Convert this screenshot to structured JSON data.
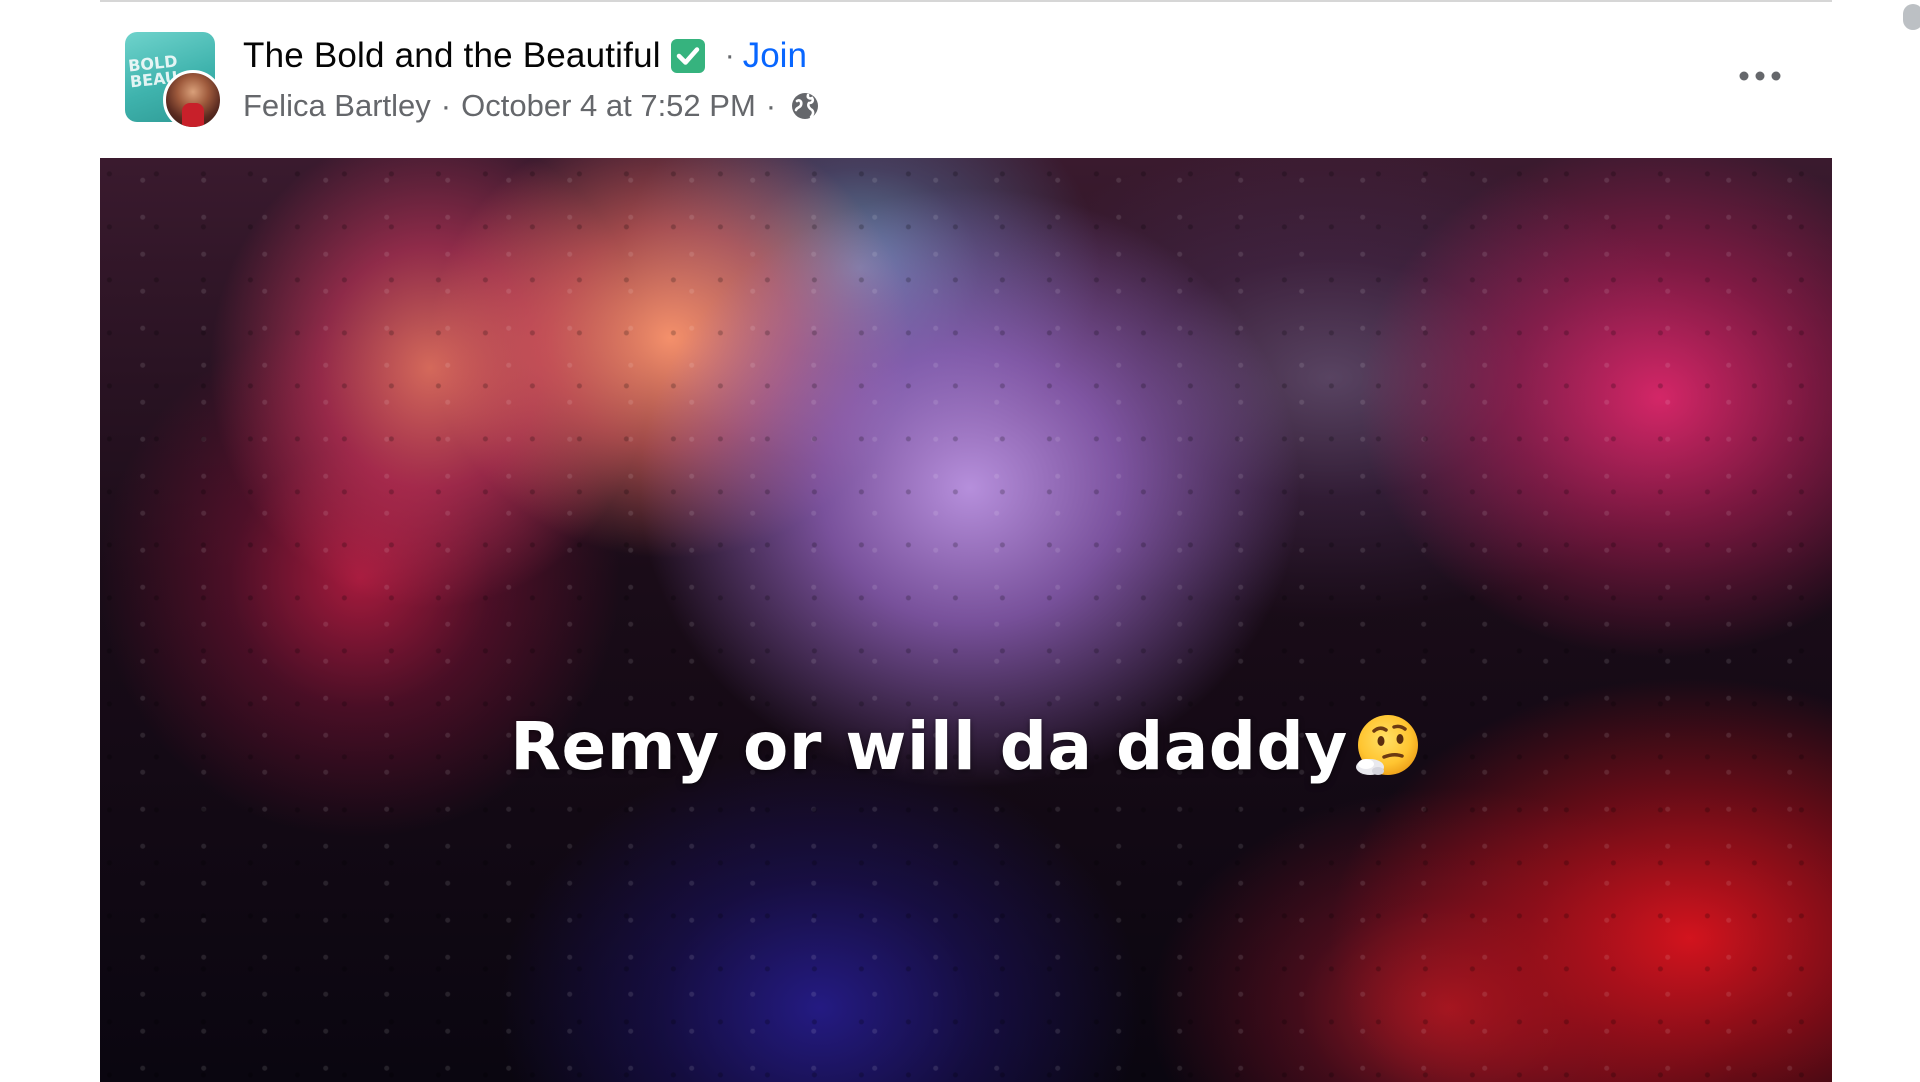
{
  "post": {
    "group_name": "The Bold and the Beautiful",
    "group_avatar_text": "BOLD BEAU",
    "join_label": "Join",
    "dot": "·",
    "author": "Felica Bartley",
    "timestamp": "October 4 at 7:52 PM",
    "audience_icon": "globe-icon",
    "verified_icon": "verified-check-icon",
    "more_icon": "more-options-icon",
    "caption": "Remy or will da daddy",
    "caption_emoji": "thinking-face-icon"
  },
  "colors": {
    "link": "#0866ff",
    "secondary_text": "#65676b",
    "primary_text": "#050505",
    "verified": "#36b37e"
  }
}
